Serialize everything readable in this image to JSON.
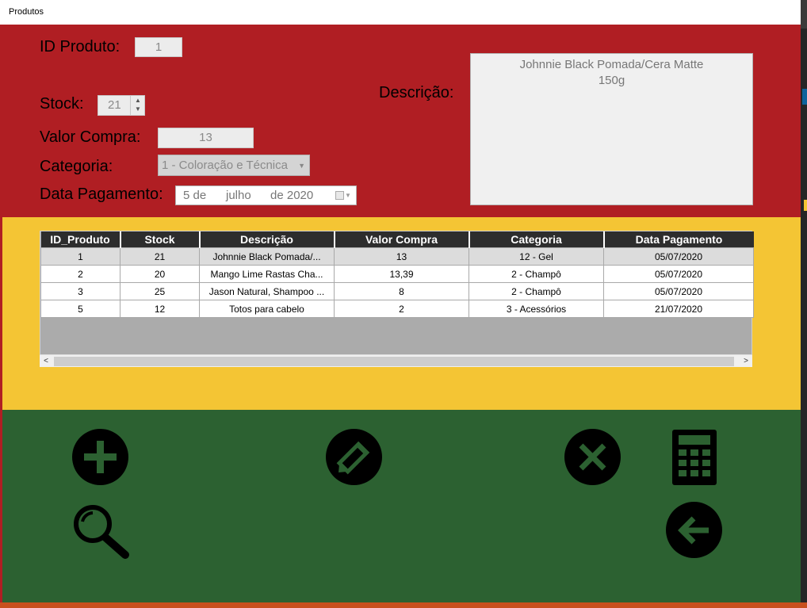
{
  "window": {
    "title": "Produtos"
  },
  "form": {
    "id_label": "ID Produto:",
    "id_value": "1",
    "stock_label": "Stock:",
    "stock_value": "21",
    "valor_label": "Valor Compra:",
    "valor_value": "13",
    "categoria_label": "Categoria:",
    "categoria_value": "1 - Coloração e Técnica",
    "data_label": "Data Pagamento:",
    "data_day": "5 de",
    "data_month": "julho",
    "data_year": "de 2020",
    "descricao_label": "Descrição:",
    "descricao_line1": "Johnnie Black Pomada/Cera Matte",
    "descricao_line2": "150g"
  },
  "grid": {
    "columns": [
      "ID_Produto",
      "Stock",
      "Descrição",
      "Valor Compra",
      "Categoria",
      "Data Pagamento"
    ],
    "rows": [
      [
        "1",
        "21",
        "Johnnie Black Pomada/...",
        "13",
        "12 - Gel",
        "05/07/2020"
      ],
      [
        "2",
        "20",
        "Mango Lime Rastas Cha...",
        "13,39",
        "2 - Champô",
        "05/07/2020"
      ],
      [
        "3",
        "25",
        "Jason Natural, Shampoo ...",
        "8",
        "2 - Champô",
        "05/07/2020"
      ],
      [
        "5",
        "12",
        "Totos para cabelo",
        "2",
        "3 - Acessórios",
        "21/07/2020"
      ]
    ],
    "scroll_left": "<",
    "scroll_right": ">"
  },
  "colors": {
    "red": "#b01e23",
    "yellow": "#f4c534",
    "green": "#2c6131"
  },
  "icons": [
    "add-icon",
    "edit-icon",
    "delete-icon",
    "calculator-icon",
    "search-icon",
    "back-arrow-icon"
  ]
}
